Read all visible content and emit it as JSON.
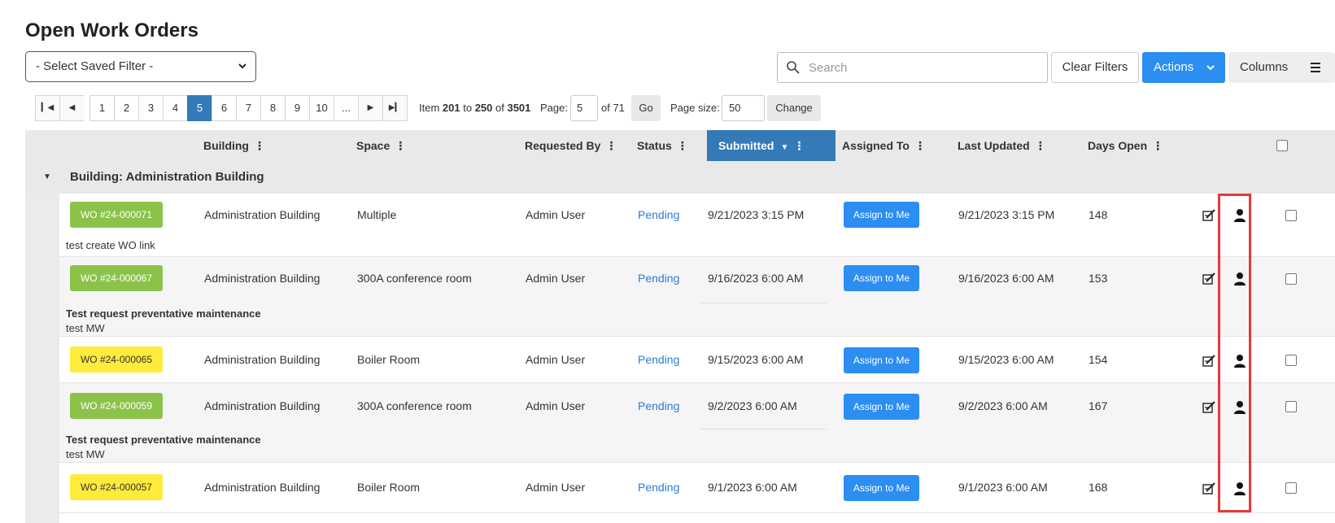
{
  "page": {
    "title": "Open Work Orders"
  },
  "toolbar": {
    "saved_filter": "- Select Saved Filter -",
    "search_placeholder": "Search",
    "clear_filters": "Clear Filters",
    "actions": "Actions",
    "columns": "Columns"
  },
  "pager": {
    "pages": [
      "1",
      "2",
      "3",
      "4",
      "5",
      "6",
      "7",
      "8",
      "9",
      "10",
      "..."
    ],
    "current": "5",
    "item_prefix": "Item ",
    "item_from": "201",
    "item_to_word": " to ",
    "item_to": "250",
    "item_of_word": " of ",
    "item_total": "3501",
    "page_label": "Page:",
    "page_value": "5",
    "of_pages": "of 71",
    "go": "Go",
    "size_label": "Page size:",
    "size_value": "50",
    "change": "Change"
  },
  "columns": {
    "building": "Building",
    "space": "Space",
    "requested_by": "Requested By",
    "status": "Status",
    "submitted": "Submitted",
    "assigned_to": "Assigned To",
    "last_updated": "Last Updated",
    "days_open": "Days Open"
  },
  "group": {
    "label": "Building: Administration Building"
  },
  "rows": [
    {
      "wo": "WO #24-000071",
      "badge": "green",
      "building": "Administration Building",
      "space": "Multiple",
      "requested_by": "Admin User",
      "status": "Pending",
      "submitted": "9/21/2023 3:15 PM",
      "assign": "Assign to Me",
      "last_updated": "9/21/2023 3:15 PM",
      "days_open": "148",
      "note_title": "",
      "note": "test create WO link"
    },
    {
      "wo": "WO #24-000067",
      "badge": "green",
      "building": "Administration Building",
      "space": "300A conference room",
      "requested_by": "Admin User",
      "status": "Pending",
      "submitted": "9/16/2023 6:00 AM",
      "assign": "Assign to Me",
      "last_updated": "9/16/2023 6:00 AM",
      "days_open": "153",
      "note_title": "Test request preventative maintenance",
      "note": "test MW"
    },
    {
      "wo": "WO #24-000065",
      "badge": "yellow",
      "building": "Administration Building",
      "space": "Boiler Room",
      "requested_by": "Admin User",
      "status": "Pending",
      "submitted": "9/15/2023 6:00 AM",
      "assign": "Assign to Me",
      "last_updated": "9/15/2023 6:00 AM",
      "days_open": "154",
      "note_title": "",
      "note": ""
    },
    {
      "wo": "WO #24-000059",
      "badge": "green",
      "building": "Administration Building",
      "space": "300A conference room",
      "requested_by": "Admin User",
      "status": "Pending",
      "submitted": "9/2/2023 6:00 AM",
      "assign": "Assign to Me",
      "last_updated": "9/2/2023 6:00 AM",
      "days_open": "167",
      "note_title": "Test request preventative maintenance",
      "note": "test MW"
    },
    {
      "wo": "WO #24-000057",
      "badge": "yellow",
      "building": "Administration Building",
      "space": "Boiler Room",
      "requested_by": "Admin User",
      "status": "Pending",
      "submitted": "9/1/2023 6:00 AM",
      "assign": "Assign to Me",
      "last_updated": "9/1/2023 6:00 AM",
      "days_open": "168",
      "note_title": "",
      "note": ""
    }
  ],
  "colors": {
    "accent": "#2b8ef0",
    "sorted_header": "#337ab7",
    "badge_green": "#8bc34a",
    "badge_yellow": "#ffeb3b",
    "highlight": "#e53935"
  }
}
